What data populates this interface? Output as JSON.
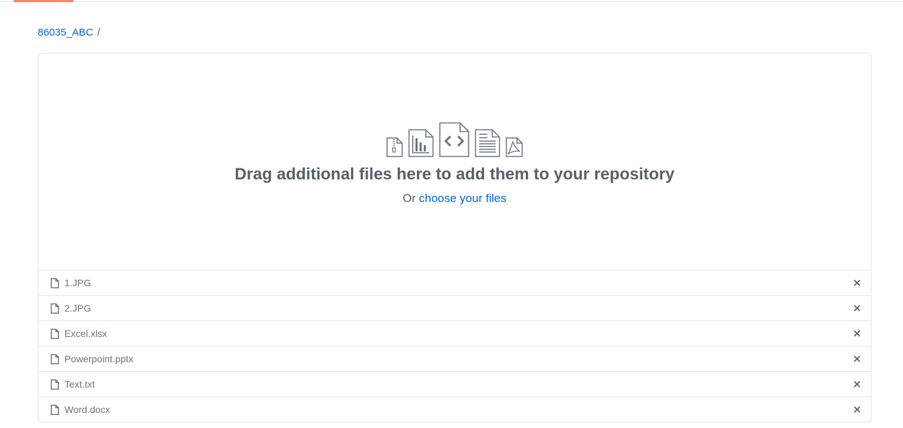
{
  "breadcrumb": {
    "repo": "86035_ABC",
    "separator": "/"
  },
  "dropzone": {
    "title": "Drag additional files here to add them to your repository",
    "prefix": "Or",
    "link": "choose your files",
    "icons": [
      "zip-file-icon",
      "chart-file-icon",
      "code-file-icon",
      "text-file-icon",
      "pdf-file-icon"
    ]
  },
  "files": [
    {
      "name": "1.JPG"
    },
    {
      "name": "2.JPG"
    },
    {
      "name": "Excel.xlsx"
    },
    {
      "name": "Powerpoint.pptx"
    },
    {
      "name": "Text.txt"
    },
    {
      "name": "Word.docx"
    }
  ],
  "colors": {
    "accent": "#0366d6",
    "border": "#e1e4e8",
    "tab_accent": "#f9826c",
    "muted": "#586069"
  }
}
